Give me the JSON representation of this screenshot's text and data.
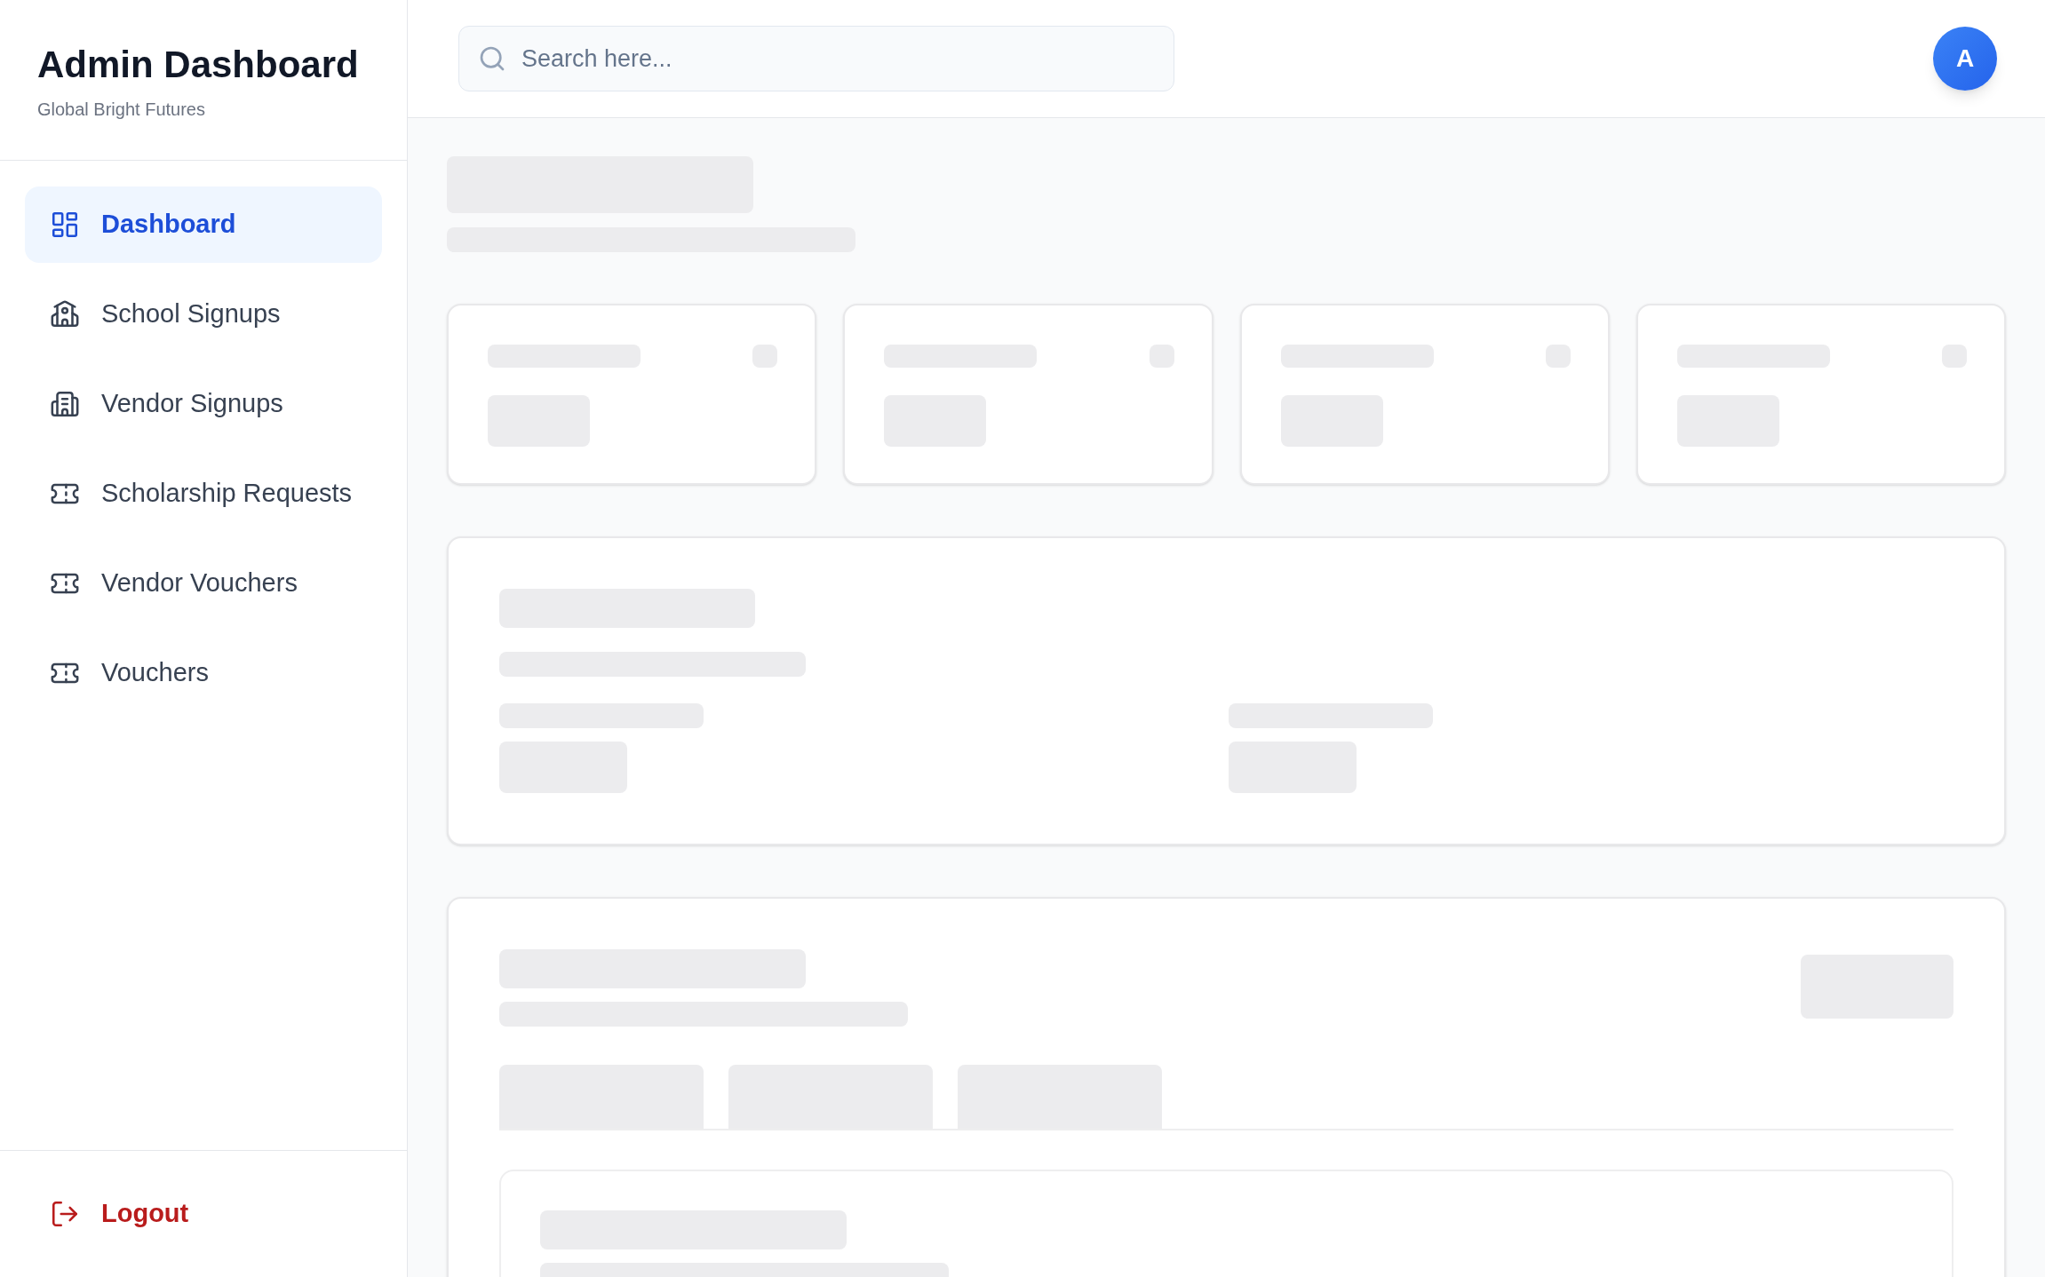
{
  "sidebar": {
    "title": "Admin Dashboard",
    "subtitle": "Global Bright Futures",
    "items": [
      {
        "label": "Dashboard",
        "kind": "grid",
        "selected": true
      },
      {
        "label": "School Signups",
        "kind": "school",
        "selected": false
      },
      {
        "label": "Vendor Signups",
        "kind": "building",
        "selected": false
      },
      {
        "label": "Scholarship Requests",
        "kind": "ticket",
        "selected": false
      },
      {
        "label": "Vendor Vouchers",
        "kind": "ticket",
        "selected": false
      },
      {
        "label": "Vouchers",
        "kind": "ticket",
        "selected": false
      }
    ],
    "logout": "Logout"
  },
  "header": {
    "search": {
      "placeholder": "Search here..."
    },
    "avatar": "A"
  }
}
